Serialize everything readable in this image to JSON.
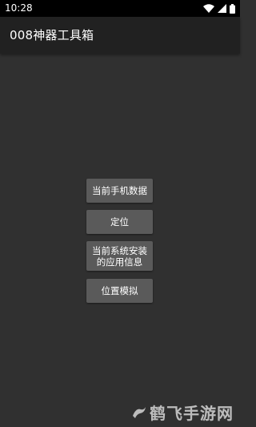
{
  "status_bar": {
    "time": "10:28",
    "icons": [
      "wifi-icon",
      "signal-icon",
      "battery-icon"
    ]
  },
  "app_bar": {
    "title": "008神器工具箱"
  },
  "buttons": {
    "phone_data": "当前手机数据",
    "location": "定位",
    "installed_apps": "当前系统安装的应用信息",
    "location_mock": "位置模拟"
  },
  "watermark": {
    "text": "鹤飞手游网"
  },
  "colors": {
    "background": "#303030",
    "app_bar": "#212121",
    "status_bar": "#000000",
    "button": "#5a5a5a",
    "text": "#ffffff"
  }
}
